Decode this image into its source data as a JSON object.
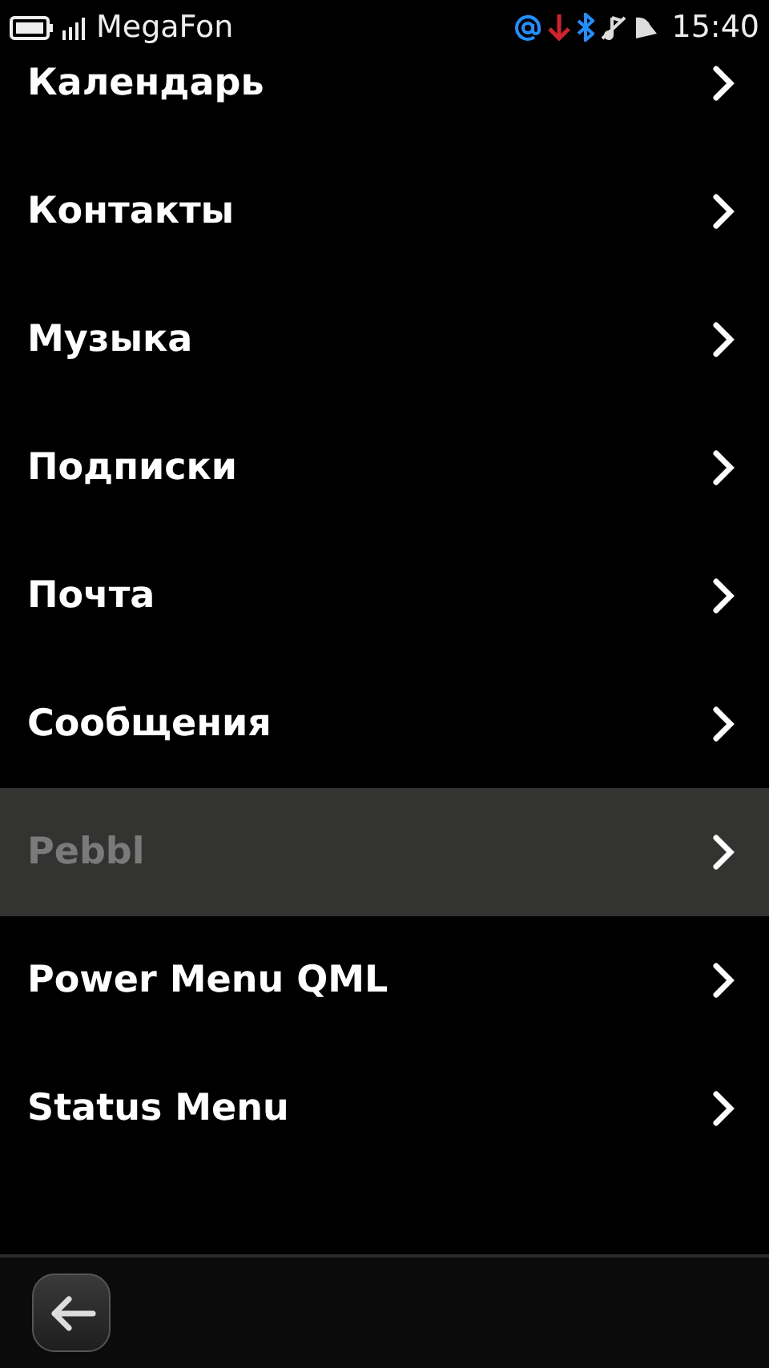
{
  "status_bar": {
    "operator": "MegaFon",
    "time": "15:40"
  },
  "menu_items": [
    {
      "label": "Календарь",
      "selected": false,
      "disabled": false
    },
    {
      "label": "Контакты",
      "selected": false,
      "disabled": false
    },
    {
      "label": "Музыка",
      "selected": false,
      "disabled": false
    },
    {
      "label": "Подписки",
      "selected": false,
      "disabled": false
    },
    {
      "label": "Почта",
      "selected": false,
      "disabled": false
    },
    {
      "label": "Сообщения",
      "selected": false,
      "disabled": false
    },
    {
      "label": "Pebbl",
      "selected": true,
      "disabled": true
    },
    {
      "label": "Power Menu QML",
      "selected": false,
      "disabled": false
    },
    {
      "label": "Status Menu",
      "selected": false,
      "disabled": false
    }
  ]
}
